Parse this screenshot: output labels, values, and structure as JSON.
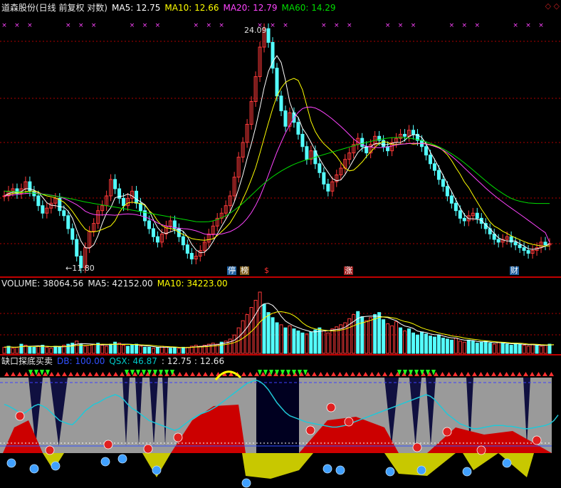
{
  "header": {
    "title": "道森股份(日线 前复权 对数)",
    "ma5": "MA5: 12.75",
    "ma10": "MA10: 12.66",
    "ma20": "MA20: 12.79",
    "ma60": "MA60: 14.29"
  },
  "volume_header": {
    "volume": "VOLUME: 38064.56",
    "ma5": "MA5: 42152.00",
    "ma10": "MA10: 34223.00"
  },
  "indicator_header": {
    "name": "缺口探底买卖",
    "db": "DB: 100.00",
    "qsx": "QSX: 46.87",
    "extra": ": 12.75 : 12.66"
  },
  "price_labels": {
    "high": "24.09",
    "low": "←11.80"
  },
  "event_markers": [
    "停",
    "榜",
    "$",
    "涨",
    "财"
  ],
  "colors": {
    "up": "#ff3a3a",
    "down": "#54ffff",
    "ma5": "#ffffff",
    "ma10": "#ffff00",
    "ma20": "#ff44ff",
    "ma60": "#00dd00",
    "grid": "#b00000"
  },
  "chart_data": [
    {
      "type": "candlestick",
      "title": "道森股份(日线 前复权 对数)",
      "y_scale": "log",
      "high": 24.09,
      "low": 11.8,
      "closes": [
        14.6,
        14.8,
        14.9,
        14.7,
        14.9,
        15.2,
        14.8,
        14.6,
        14.2,
        13.9,
        14.1,
        14.3,
        14.5,
        14.0,
        13.8,
        13.3,
        12.9,
        12.3,
        11.9,
        12.6,
        13.2,
        13.5,
        14.0,
        14.2,
        14.6,
        15.3,
        14.9,
        14.5,
        14.2,
        14.5,
        14.8,
        14.3,
        14.0,
        13.6,
        13.3,
        13.0,
        12.8,
        13.1,
        13.4,
        13.6,
        13.3,
        13.0,
        12.7,
        12.4,
        12.2,
        12.3,
        12.5,
        12.8,
        13.1,
        13.4,
        13.7,
        13.9,
        14.2,
        14.6,
        15.4,
        16.3,
        17.0,
        17.9,
        19.1,
        20.5,
        22.3,
        23.5,
        22.6,
        21.0,
        19.4,
        18.6,
        17.8,
        18.5,
        18.0,
        17.4,
        16.8,
        16.2,
        16.6,
        16.0,
        15.6,
        15.1,
        14.8,
        15.2,
        15.5,
        15.8,
        16.2,
        16.5,
        16.9,
        17.2,
        16.8,
        16.5,
        16.9,
        17.3,
        17.1,
        16.8,
        16.6,
        17.0,
        17.2,
        17.4,
        17.3,
        17.6,
        17.4,
        17.1,
        16.8,
        16.4,
        16.0,
        15.7,
        15.3,
        15.0,
        14.6,
        14.3,
        14.0,
        13.7,
        13.6,
        13.8,
        13.9,
        13.7,
        13.5,
        13.3,
        13.1,
        12.9,
        12.8,
        12.9,
        13.0,
        12.8,
        12.7,
        12.6,
        12.5,
        12.4,
        12.5,
        12.6,
        12.8,
        12.7,
        12.75
      ],
      "ma5": [
        14.6,
        14.7,
        14.75,
        14.75,
        14.78,
        14.9,
        14.9,
        14.84,
        14.74,
        14.54,
        14.32,
        14.22,
        14.2,
        14.16,
        14.14,
        13.98,
        13.7,
        13.26,
        12.84,
        12.6,
        12.58,
        12.7,
        13.04,
        13.5,
        13.9,
        14.12,
        14.52,
        14.58,
        14.6,
        14.68,
        14.6,
        14.46,
        14.36,
        14.24,
        14.0,
        13.64,
        13.34,
        13.16,
        13.12,
        13.18,
        13.24,
        13.28,
        13.2,
        13.0,
        12.72,
        12.52,
        12.42,
        12.44,
        12.58,
        12.82,
        13.1,
        13.38,
        13.66,
        13.96,
        14.36,
        14.88,
        15.5,
        16.24,
        16.94,
        17.76,
        18.76,
        19.86,
        20.8,
        21.38,
        21.76,
        21.34,
        20.28,
        19.06,
        18.46,
        18.26,
        17.7,
        17.38,
        17.0,
        16.6,
        16.24,
        15.9,
        15.62,
        15.34,
        15.24,
        15.28,
        15.52,
        15.84,
        16.18,
        16.52,
        16.72,
        16.78,
        16.8,
        16.94,
        16.96,
        16.88,
        16.9,
        16.96,
        17.0,
        17.0,
        17.1,
        17.3,
        17.38,
        17.36,
        17.24,
        16.94,
        16.54,
        16.2,
        15.84,
        15.48,
        15.12,
        14.78,
        14.44,
        14.12,
        13.84,
        13.68,
        13.68,
        13.66,
        13.62,
        13.44,
        13.3,
        13.12,
        12.96,
        12.88,
        12.84,
        12.84,
        12.84,
        12.74,
        12.66,
        12.56,
        12.54,
        12.56,
        12.6,
        12.65,
        12.75
      ],
      "ma10": [
        14.6,
        14.65,
        14.7,
        14.72,
        14.73,
        14.78,
        14.8,
        14.8,
        14.76,
        14.66,
        14.6,
        14.56,
        14.52,
        14.44,
        14.34,
        14.17,
        13.97,
        13.73,
        13.49,
        13.28,
        13.19,
        13.18,
        13.21,
        13.27,
        13.34,
        13.41,
        13.6,
        13.93,
        14.17,
        14.31,
        14.34,
        14.31,
        14.29,
        14.21,
        14.0,
        13.85,
        13.6,
        13.42,
        13.33,
        13.31,
        13.26,
        13.16,
        13.08,
        13.01,
        12.93,
        12.9,
        12.88,
        12.87,
        12.89,
        12.92,
        13.04,
        13.19,
        13.34,
        13.52,
        13.79,
        14.08,
        14.46,
        14.85,
        15.31,
        15.82,
        16.49,
        17.22,
        17.97,
        18.72,
        19.4,
        19.85,
        20.17,
        20.31,
        20.4,
        20.28,
        19.75,
        18.88,
        18.04,
        17.53,
        17.2,
        16.94,
        16.75,
        16.56,
        16.34,
        16.06,
        15.79,
        15.68,
        15.71,
        15.88,
        16.08,
        16.33,
        16.55,
        16.76,
        16.96,
        17.04,
        17.0,
        16.9,
        16.9,
        16.93,
        16.93,
        16.96,
        16.92,
        16.94,
        16.96,
        16.94,
        16.89,
        16.84,
        16.77,
        16.61,
        16.41,
        16.14,
        15.82,
        15.53,
        15.19,
        14.95,
        14.64,
        14.35,
        14.06,
        13.81,
        13.56,
        13.4,
        13.31,
        13.2,
        13.12,
        13.03,
        12.96,
        12.89,
        12.82,
        12.76,
        12.72,
        12.69,
        12.66,
        12.66,
        12.66
      ],
      "ma20": [
        14.6,
        14.62,
        14.64,
        14.66,
        14.68,
        14.7,
        14.71,
        14.72,
        14.71,
        14.68,
        14.66,
        14.63,
        14.6,
        14.55,
        14.5,
        14.42,
        14.33,
        14.24,
        14.12,
        13.98,
        13.9,
        13.85,
        13.83,
        13.83,
        13.84,
        13.83,
        13.82,
        13.84,
        13.86,
        13.87,
        13.86,
        13.84,
        13.8,
        13.75,
        13.69,
        13.61,
        13.52,
        13.45,
        13.4,
        13.37,
        13.34,
        13.32,
        13.3,
        13.29,
        13.26,
        13.22,
        13.16,
        13.1,
        13.08,
        13.08,
        13.09,
        13.1,
        13.14,
        13.19,
        13.27,
        13.37,
        13.51,
        13.69,
        13.92,
        14.21,
        14.57,
        15.0,
        15.5,
        16.02,
        16.54,
        17.01,
        17.47,
        17.86,
        18.23,
        18.52,
        18.72,
        18.79,
        18.8,
        18.75,
        18.64,
        18.5,
        18.34,
        18.17,
        17.98,
        17.79,
        17.59,
        17.38,
        17.17,
        17.01,
        16.89,
        16.82,
        16.78,
        16.76,
        16.75,
        16.76,
        16.79,
        16.83,
        16.88,
        16.91,
        16.93,
        16.95,
        16.96,
        16.96,
        16.95,
        16.92,
        16.87,
        16.81,
        16.73,
        16.63,
        16.5,
        16.35,
        16.18,
        16.0,
        15.81,
        15.63,
        15.45,
        15.27,
        15.1,
        14.93,
        14.77,
        14.62,
        14.48,
        14.35,
        14.22,
        14.1,
        13.98,
        13.86,
        13.74,
        13.62,
        13.5,
        13.38,
        13.26,
        13.15,
        12.79
      ],
      "ma60": [
        14.8,
        14.79,
        14.78,
        14.77,
        14.76,
        14.75,
        14.73,
        14.71,
        14.69,
        14.67,
        14.65,
        14.62,
        14.59,
        14.56,
        14.53,
        14.5,
        14.47,
        14.43,
        14.39,
        14.35,
        14.32,
        14.29,
        14.26,
        14.23,
        14.2,
        14.17,
        14.14,
        14.11,
        14.08,
        14.05,
        14.02,
        13.99,
        13.96,
        13.93,
        13.9,
        13.87,
        13.84,
        13.81,
        13.78,
        13.75,
        13.72,
        13.69,
        13.66,
        13.63,
        13.6,
        13.57,
        13.56,
        13.56,
        13.57,
        13.6,
        13.65,
        13.72,
        13.8,
        13.9,
        14.02,
        14.15,
        14.3,
        14.46,
        14.63,
        14.8,
        14.97,
        15.13,
        15.28,
        15.42,
        15.55,
        15.67,
        15.78,
        15.88,
        15.97,
        16.05,
        16.12,
        16.18,
        16.24,
        16.3,
        16.36,
        16.42,
        16.48,
        16.54,
        16.6,
        16.66,
        16.72,
        16.78,
        16.84,
        16.9,
        16.95,
        17.0,
        17.05,
        17.1,
        17.14,
        17.18,
        17.21,
        17.23,
        17.24,
        17.24,
        17.23,
        17.21,
        17.18,
        17.14,
        17.09,
        17.03,
        16.96,
        16.88,
        16.79,
        16.69,
        16.58,
        16.46,
        16.33,
        16.19,
        16.04,
        15.88,
        15.72,
        15.56,
        15.4,
        15.24,
        15.09,
        14.95,
        14.82,
        14.7,
        14.59,
        14.5,
        14.43,
        14.38,
        14.34,
        14.31,
        14.3,
        14.29,
        14.29,
        14.29,
        14.29
      ]
    },
    {
      "type": "bar",
      "title": "VOLUME",
      "volume": 38064.56,
      "ma5": 42152.0,
      "ma10": 34223.0,
      "values": [
        6,
        7,
        5,
        6,
        9,
        8,
        7,
        6,
        7,
        8,
        6,
        5,
        7,
        6,
        8,
        9,
        10,
        12,
        9,
        7,
        8,
        9,
        10,
        8,
        7,
        9,
        11,
        10,
        8,
        7,
        8,
        9,
        7,
        6,
        6,
        5,
        6,
        7,
        6,
        5,
        6,
        5,
        6,
        6,
        7,
        8,
        7,
        8,
        9,
        10,
        9,
        11,
        12,
        14,
        18,
        25,
        32,
        38,
        45,
        52,
        60,
        48,
        40,
        35,
        30,
        28,
        25,
        27,
        24,
        22,
        20,
        19,
        21,
        23,
        25,
        22,
        20,
        24,
        26,
        28,
        30,
        34,
        38,
        41,
        36,
        32,
        35,
        38,
        40,
        33,
        29,
        27,
        31,
        25,
        22,
        24,
        20,
        18,
        21,
        19,
        17,
        16,
        18,
        15,
        14,
        13,
        15,
        12,
        11,
        13,
        12,
        10,
        11,
        12,
        10,
        9,
        11,
        10,
        9,
        8,
        10,
        9,
        8,
        7,
        9,
        8,
        7,
        8,
        9,
        10
      ],
      "up_flags": [
        1,
        0,
        1,
        1,
        0,
        1,
        0,
        0,
        1,
        0,
        1,
        1,
        0,
        0,
        1,
        0,
        0,
        1,
        0,
        1,
        1,
        1,
        0,
        1,
        1,
        0,
        0,
        1,
        1,
        0,
        0,
        0,
        1,
        0,
        0,
        1,
        0,
        1,
        1,
        0,
        0,
        1,
        0,
        1,
        1,
        1,
        1,
        1,
        1,
        1,
        1,
        0,
        1,
        1,
        1,
        1,
        1,
        1,
        1,
        1,
        1,
        0,
        0,
        0,
        0,
        1,
        0,
        1,
        0,
        0,
        0,
        1,
        0,
        0,
        0,
        1,
        1,
        1,
        1,
        1,
        1,
        1,
        1,
        0,
        0,
        1,
        1,
        0,
        0,
        0,
        1,
        1,
        1,
        0,
        1,
        0,
        0,
        0,
        0,
        0,
        0,
        0,
        0,
        0,
        0,
        0,
        1,
        1,
        1,
        0,
        0,
        0,
        0,
        0,
        0,
        1,
        1,
        0,
        0,
        0,
        0,
        0,
        1,
        1,
        1,
        0,
        1,
        1
      ]
    },
    {
      "type": "area",
      "title": "缺口探底买卖",
      "db": 100.0,
      "qsx": 46.87,
      "qsx_line": [
        60,
        58,
        55,
        52,
        48,
        50,
        54,
        58,
        60,
        58,
        55,
        50,
        45,
        40,
        38,
        36,
        35,
        40,
        46,
        52,
        56,
        60,
        62,
        65,
        68,
        70,
        72,
        70,
        66,
        60,
        55,
        52,
        48,
        44,
        40,
        38,
        36,
        34,
        32,
        30,
        28,
        30,
        34,
        38,
        42,
        45,
        48,
        50,
        52,
        55,
        58,
        62,
        66,
        70,
        74,
        78,
        82,
        86,
        88,
        90,
        88,
        84,
        78,
        70,
        62,
        56,
        50,
        46,
        44,
        42,
        40,
        38,
        37,
        36,
        35,
        34,
        33,
        32,
        32,
        33,
        34,
        36,
        38,
        40,
        42,
        44,
        46,
        48,
        50,
        52,
        54,
        56,
        58,
        60,
        62,
        64,
        66,
        68,
        70,
        72,
        70,
        66,
        60,
        54,
        48,
        44,
        40,
        36,
        34,
        32,
        30,
        30,
        31,
        32,
        33,
        34,
        34,
        34,
        33,
        33,
        32,
        31,
        30,
        30,
        31,
        32,
        33,
        34,
        36,
        40,
        46.87
      ]
    }
  ]
}
